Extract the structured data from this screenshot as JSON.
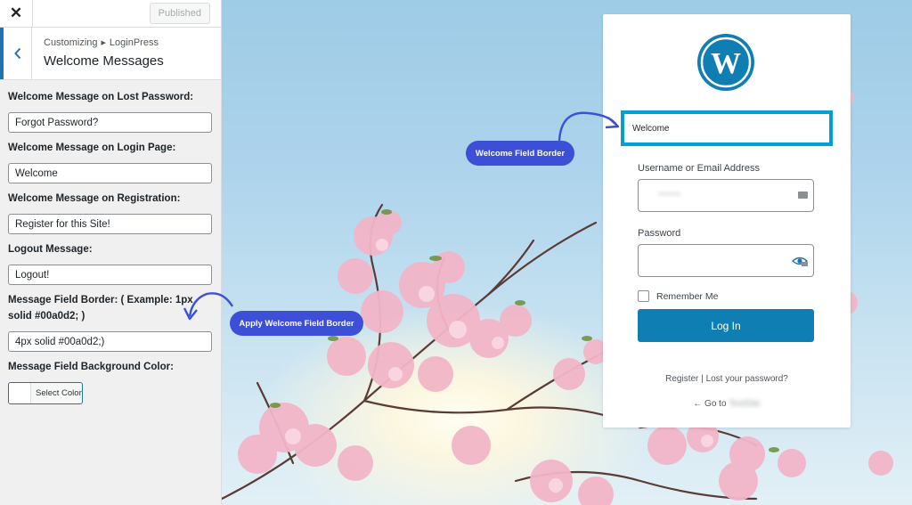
{
  "sidebar": {
    "close_icon": "close-icon",
    "publish_label": "Published",
    "breadcrumb": {
      "root": "Customizing",
      "current": "LoginPress"
    },
    "section_title": "Welcome Messages",
    "controls": [
      {
        "label": "Welcome Message on Lost Password:",
        "value": "Forgot Password?"
      },
      {
        "label": "Welcome Message on Login Page:",
        "value": "Welcome"
      },
      {
        "label": "Welcome Message on Registration:",
        "value": "Register for this Site!"
      },
      {
        "label": "Logout Message:",
        "value": "Logout!"
      },
      {
        "label": "Message Field Border: ( Example: 1px solid #00a0d2; )",
        "value": "4px solid #00a0d2;)"
      }
    ],
    "bg_color_label": "Message Field Background Color:",
    "select_color_label": "Select Color"
  },
  "preview": {
    "welcome_text": "Welcome",
    "username_label": "Username or Email Address",
    "password_label": "Password",
    "remember_label": "Remember Me",
    "login_label": "Log In",
    "register_link": "Register",
    "separator": "|",
    "lost_password_link": "Lost your password?",
    "goto_prefix": "← Go to",
    "welcome_border_color": "#00a0d2",
    "accent": "#0f7fb3"
  },
  "annotations": {
    "welcome_field_border": "Welcome Field Border",
    "apply_welcome_field_border": "Apply Welcome Field Border",
    "pill_color": "#3d4fd6"
  }
}
